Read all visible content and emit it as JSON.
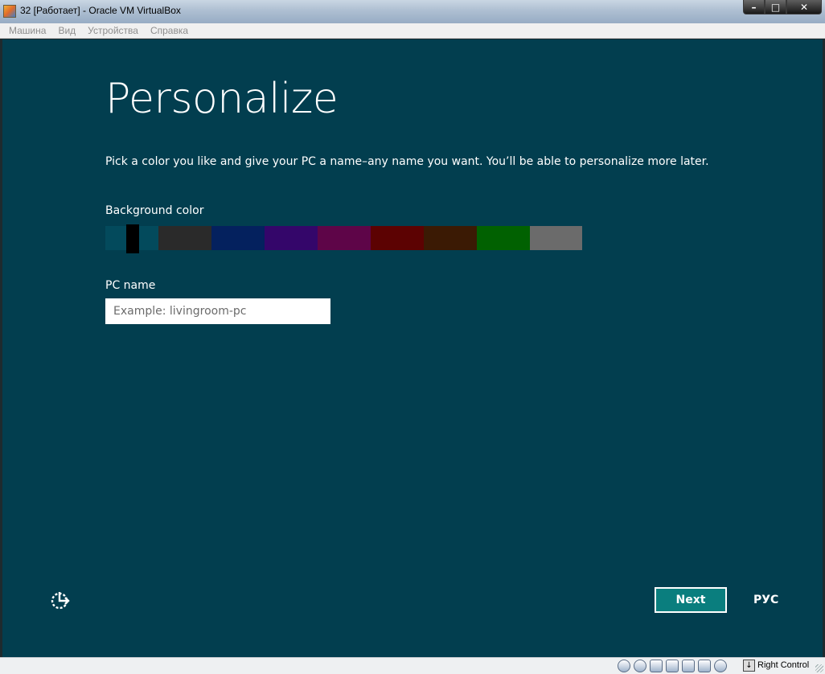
{
  "window": {
    "title": "32 [Работает] - Oracle VM VirtualBox",
    "controls": {
      "minimize": "–",
      "maximize": "□",
      "close": "✕"
    }
  },
  "menu": [
    "Машина",
    "Вид",
    "Устройства",
    "Справка"
  ],
  "setup": {
    "title": "Personalize",
    "subtitle": "Pick a color you like and give your PC a name–any name you want. You’ll be able to personalize more later.",
    "background_label": "Background color",
    "colors": [
      "#034a5c",
      "#2a2a2a",
      "#04215e",
      "#34066a",
      "#5e0548",
      "#5c0202",
      "#3b1a04",
      "#016101",
      "#6b6b6b"
    ],
    "selected_color_index": 0,
    "pc_name_label": "PC name",
    "pc_name_placeholder": "Example: livingroom-pc",
    "pc_name_value": "",
    "next_label": "Next",
    "language": "РУС",
    "ease_icon": "ease-of-access-icon"
  },
  "statusbar": {
    "icons": [
      "hard-disk-icon",
      "optical-disk-icon",
      "usb-icon",
      "network-icon",
      "shared-folder-icon",
      "display-icon",
      "capture-icon"
    ],
    "host_key": "Right Control"
  }
}
